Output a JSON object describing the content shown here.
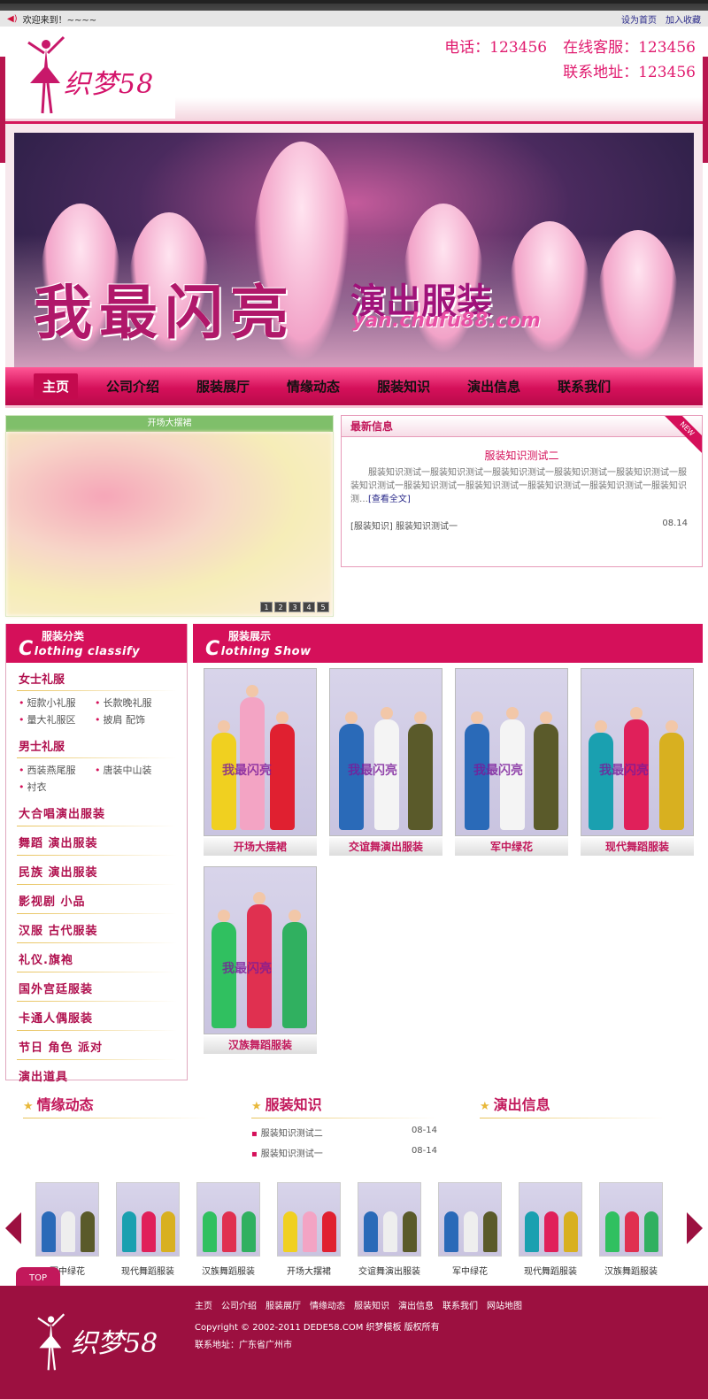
{
  "topbar": {
    "welcome": "欢迎来到！~~~~",
    "set_home": "设为首页",
    "add_fav": "加入收藏"
  },
  "header": {
    "brand": "织梦58",
    "phone": "电话：123456",
    "service": "在线客服：123456",
    "address": "联系地址：123456"
  },
  "banner": {
    "title1": "我最闪亮",
    "title2": "演出服装",
    "url": "yan.chufu88.com"
  },
  "nav": [
    "主页",
    "公司介绍",
    "服装展厅",
    "情缘动态",
    "服装知识",
    "演出信息",
    "联系我们"
  ],
  "slider": {
    "caption": "开场大摆裙",
    "pages": [
      "1",
      "2",
      "3",
      "4",
      "5"
    ]
  },
  "latest": {
    "heading": "最新信息",
    "ribbon": "NEW",
    "title": "服装知识测试二",
    "desc": "服装知识测试一服装知识测试一服装知识测试一服装知识测试一服装知识测试一服装知识测试一服装知识测试一服装知识测试一服装知识测试一服装知识测试一服装知识测…",
    "more": "[查看全文]",
    "item": "[服装知识] 服装知识测试一",
    "item_date": "08.14"
  },
  "sidebar": {
    "head_cn": "服装分类",
    "head_en_first": "C",
    "head_en_rest": "lothing classify",
    "groups": [
      {
        "title": "女士礼服",
        "subs": [
          "短款小礼服",
          "长款晚礼服",
          "量大礼服区",
          "披肩 配饰"
        ]
      },
      {
        "title": "男士礼服",
        "subs": [
          "西装燕尾服",
          "唐装中山装",
          "衬衣"
        ]
      }
    ],
    "links": [
      "大合唱演出服装",
      "舞蹈 演出服装",
      "民族 演出服装",
      "影视剧 小品",
      "汉服 古代服装",
      "礼仪.旗袍",
      "国外宫廷服装",
      "卡通人偶服装",
      "节日 角色 派对",
      "演出道具"
    ]
  },
  "show": {
    "head_cn": "服装展示",
    "head_en_first": "C",
    "head_en_rest": "lothing Show",
    "watermark": "我最闪亮",
    "items": [
      "开场大摆裙",
      "交谊舞演出服装",
      "军中绿花",
      "现代舞蹈服装",
      "汉族舞蹈服装"
    ]
  },
  "columns": [
    {
      "title": "情缘动态",
      "items": []
    },
    {
      "title": "服装知识",
      "items": [
        {
          "text": "服装知识测试二",
          "date": "08-14"
        },
        {
          "text": "服装知识测试一",
          "date": "08-14"
        }
      ]
    },
    {
      "title": "演出信息",
      "items": []
    }
  ],
  "scroller": [
    "军中绿花",
    "现代舞蹈服装",
    "汉族舞蹈服装",
    "开场大摆裙",
    "交谊舞演出服装",
    "军中绿花",
    "现代舞蹈服装",
    "汉族舞蹈服装"
  ],
  "footer": {
    "top": "TOP",
    "brand": "织梦58",
    "links": [
      "主页",
      "公司介绍",
      "服装展厅",
      "情缘动态",
      "服装知识",
      "演出信息",
      "联系我们",
      "网站地图"
    ],
    "copyright": "Copyright © 2002-2011 DEDE58.COM 织梦模板 版权所有",
    "address": "联系地址：广东省广州市"
  }
}
